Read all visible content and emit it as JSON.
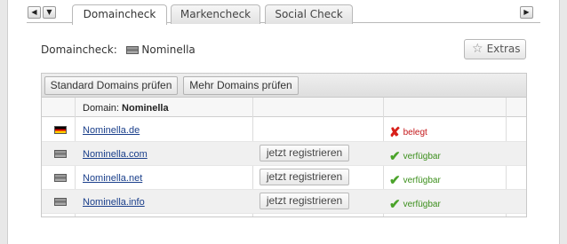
{
  "tabs": {
    "items": [
      {
        "label": "Domaincheck",
        "active": true
      },
      {
        "label": "Markencheck",
        "active": false
      },
      {
        "label": "Social Check",
        "active": false
      }
    ],
    "nav_left_icon": "triangle-left-icon",
    "nav_menu_icon": "triangle-down-icon",
    "nav_right_icon": "triangle-right-icon"
  },
  "header": {
    "label": "Domaincheck:",
    "name": "Nominella",
    "extras_label": "Extras",
    "extras_icon": "star-outline-icon"
  },
  "toolbar": {
    "standard_label": "Standard Domains prüfen",
    "more_label": "Mehr Domains prüfen"
  },
  "grid": {
    "header_prefix": "Domain:",
    "header_name": "Nominella",
    "rows": [
      {
        "flag": "de-flag-icon",
        "domain": "Nominella.de",
        "action": "",
        "status": "belegt",
        "status_type": "taken"
      },
      {
        "flag": "generic-flag-icon",
        "domain": "Nominella.com",
        "action": "jetzt registrieren",
        "status": "verfügbar",
        "status_type": "free"
      },
      {
        "flag": "generic-flag-icon",
        "domain": "Nominella.net",
        "action": "jetzt registrieren",
        "status": "verfügbar",
        "status_type": "free"
      },
      {
        "flag": "generic-flag-icon",
        "domain": "Nominella.info",
        "action": "jetzt registrieren",
        "status": "verfügbar",
        "status_type": "free"
      }
    ]
  },
  "colors": {
    "link": "#1a3f8b",
    "taken": "#d8201a",
    "free": "#4aa32a"
  }
}
